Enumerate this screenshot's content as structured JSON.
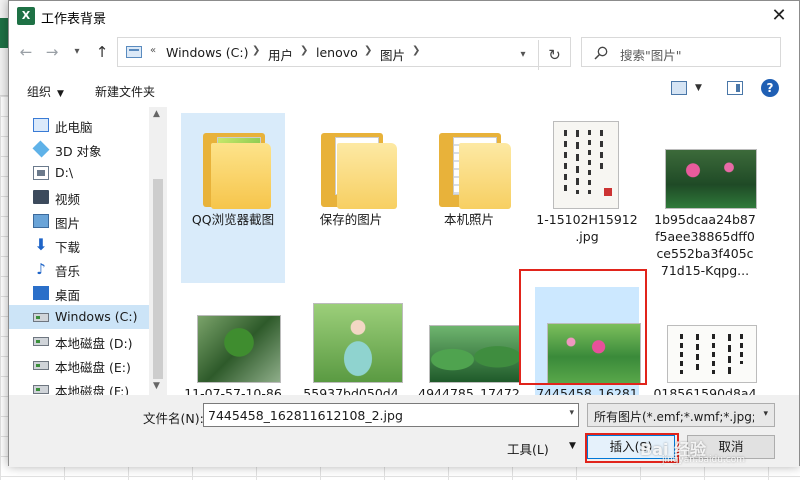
{
  "dialog": {
    "title": "工作表背景",
    "app_icon_letter": "X"
  },
  "address": {
    "overflow": "«",
    "segments": [
      "Windows (C:)",
      "用户",
      "lenovo",
      "图片"
    ]
  },
  "search": {
    "placeholder": "搜索\"图片\""
  },
  "toolbar": {
    "organize": "组织",
    "new_folder": "新建文件夹"
  },
  "nav_pane": {
    "items": [
      {
        "label": "此电脑",
        "icon": "computer-icon"
      },
      {
        "label": "3D 对象",
        "icon": "cube-icon"
      },
      {
        "label": "D:\\",
        "icon": "document-icon"
      },
      {
        "label": "视频",
        "icon": "video-icon"
      },
      {
        "label": "图片",
        "icon": "picture-icon"
      },
      {
        "label": "下载",
        "icon": "download-icon"
      },
      {
        "label": "音乐",
        "icon": "music-icon"
      },
      {
        "label": "桌面",
        "icon": "desktop-icon"
      },
      {
        "label": "Windows (C:)",
        "icon": "drive-icon",
        "selected": true
      },
      {
        "label": "本地磁盘 (D:)",
        "icon": "drive-icon"
      },
      {
        "label": "本地磁盘 (E:)",
        "icon": "drive-icon"
      },
      {
        "label": "本地磁盘 (F:)",
        "icon": "drive-icon"
      }
    ]
  },
  "files": [
    {
      "label": "QQ浏览器截图",
      "kind": "folder-green"
    },
    {
      "label": "保存的图片",
      "kind": "folder-paper"
    },
    {
      "label": "本机照片",
      "kind": "folder-doc"
    },
    {
      "label": "1-15102H15912\n.jpg",
      "kind": "calligraphy"
    },
    {
      "label": "1b95dcaa24b87f5aee38865dff0ce552ba3f405c71d15-Kqpg...",
      "kind": "lotus-dark"
    },
    {
      "label": "11-07-57-10-86",
      "kind": "plant"
    },
    {
      "label": "55937bd050d4",
      "kind": "girl"
    },
    {
      "label": "4944785_17472",
      "kind": "lotus-leaves"
    },
    {
      "label": "7445458_16281",
      "kind": "lotus-pink",
      "selected": true
    },
    {
      "label": "018561590d8a4",
      "kind": "calligraphy2"
    }
  ],
  "bottom": {
    "filename_label": "文件名(N):",
    "filename_value": "7445458_162811612108_2.jpg",
    "filetype_value": "所有图片(*.emf;*.wmf;*.jpg;*.jp",
    "tools_label": "工具(L)",
    "insert_label": "插入(S)",
    "cancel_label": "取消"
  },
  "watermark": {
    "main": "Bai 经验",
    "sub": "jingyan.baidu.com"
  }
}
